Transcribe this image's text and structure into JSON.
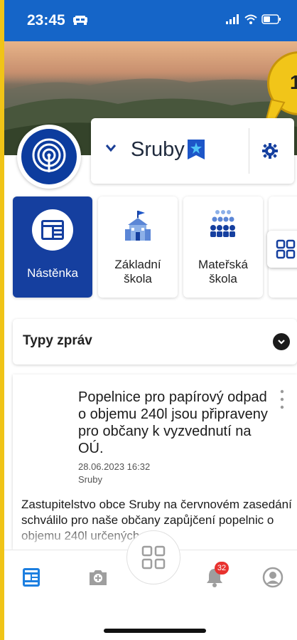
{
  "status_bar": {
    "time": "23:45"
  },
  "callout": {
    "number": "1"
  },
  "municipality": {
    "name": "Sruby"
  },
  "tiles": [
    {
      "label": "Nástěnka",
      "active": true
    },
    {
      "label": "Základní\nškola",
      "active": false
    },
    {
      "label": "Mateřská\nškola",
      "active": false
    }
  ],
  "message_types": {
    "label": "Typy zpráv"
  },
  "news": {
    "title": "Popelnice pro papírový odpad o objemu 240l jsou připraveny pro občany k vyzvednutí na OÚ.",
    "date": "28.06.2023 16:32",
    "source": "Sruby",
    "body": "Zastupitelstvo obce Sruby na červnovém zasedání schválilo pro naše občany zapůjčení popelnic o objemu 240l určených"
  },
  "bottom_nav": {
    "notification_count": "32"
  },
  "colors": {
    "brand_blue": "#153f9f",
    "status_blue": "#1565c8",
    "badge_red": "#e8322f",
    "callout_yellow": "#f1c519"
  }
}
